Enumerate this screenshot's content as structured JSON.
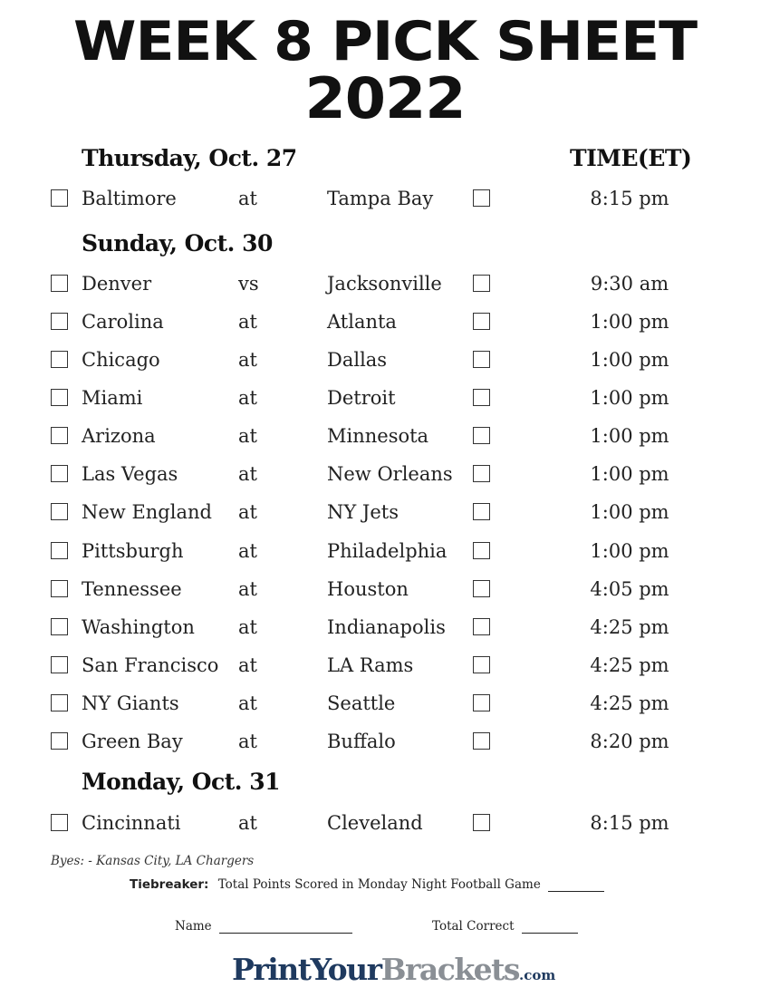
{
  "title": {
    "line1": "WEEK 8 PICK SHEET",
    "line2": "2022"
  },
  "time_header": "TIME(ET)",
  "days": [
    {
      "label": "Thursday, Oct. 27",
      "games": [
        {
          "away": "Baltimore",
          "sep": "at",
          "home": "Tampa Bay",
          "time": "8:15 pm"
        }
      ]
    },
    {
      "label": "Sunday, Oct. 30",
      "games": [
        {
          "away": "Denver",
          "sep": "vs",
          "home": "Jacksonville",
          "time": "9:30 am"
        },
        {
          "away": "Carolina",
          "sep": "at",
          "home": "Atlanta",
          "time": "1:00 pm"
        },
        {
          "away": "Chicago",
          "sep": "at",
          "home": "Dallas",
          "time": "1:00 pm"
        },
        {
          "away": "Miami",
          "sep": "at",
          "home": "Detroit",
          "time": "1:00 pm"
        },
        {
          "away": "Arizona",
          "sep": "at",
          "home": "Minnesota",
          "time": "1:00 pm"
        },
        {
          "away": "Las Vegas",
          "sep": "at",
          "home": "New Orleans",
          "time": "1:00 pm"
        },
        {
          "away": "New England",
          "sep": "at",
          "home": "NY Jets",
          "time": "1:00 pm"
        },
        {
          "away": "Pittsburgh",
          "sep": "at",
          "home": "Philadelphia",
          "time": "1:00 pm"
        },
        {
          "away": "Tennessee",
          "sep": "at",
          "home": "Houston",
          "time": "4:05 pm"
        },
        {
          "away": "Washington",
          "sep": "at",
          "home": "Indianapolis",
          "time": "4:25 pm"
        },
        {
          "away": "San Francisco",
          "sep": "at",
          "home": "LA Rams",
          "time": "4:25 pm"
        },
        {
          "away": "NY Giants",
          "sep": "at",
          "home": "Seattle",
          "time": "4:25 pm"
        },
        {
          "away": "Green Bay",
          "sep": "at",
          "home": "Buffalo",
          "time": "8:20 pm"
        }
      ]
    },
    {
      "label": "Monday, Oct. 31",
      "games": [
        {
          "away": "Cincinnati",
          "sep": "at",
          "home": "Cleveland",
          "time": "8:15 pm"
        }
      ]
    }
  ],
  "byes": "Byes: - Kansas City, LA Chargers",
  "tiebreaker": {
    "label": "Tiebreaker:",
    "text": "Total Points Scored in Monday Night Football Game"
  },
  "name_label": "Name",
  "total_label": "Total Correct",
  "logo": {
    "part1": "PrintYour",
    "part2": "Brackets",
    "part3": ".com"
  }
}
